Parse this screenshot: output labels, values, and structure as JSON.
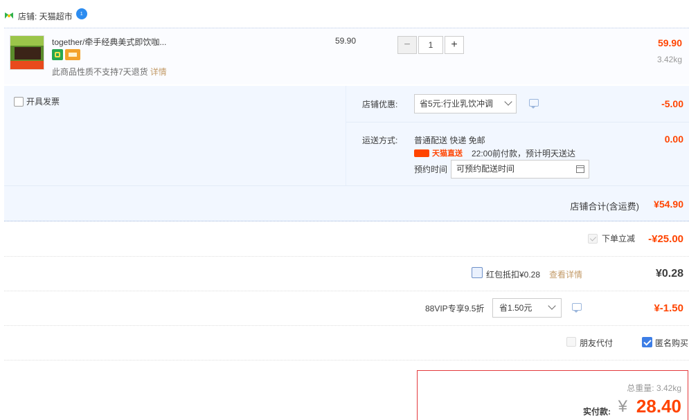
{
  "shop": {
    "label": "店铺: 天猫超市",
    "badge": "1"
  },
  "item": {
    "title": "together/牵手经典美式即饮咖...",
    "note": "此商品性质不支持7天退货",
    "note_link": "详情",
    "unit_price": "59.90",
    "quantity": "1",
    "minus": "−",
    "plus": "+",
    "total": "59.90",
    "weight": "3.42kg"
  },
  "invoice": {
    "label": "开具发票"
  },
  "shop_discount": {
    "label": "店铺优惠:",
    "selected": "省5元:行业乳饮冲调",
    "amount": "-5.00"
  },
  "shipping": {
    "label": "运送方式:",
    "method": "普通配送 快递 免邮",
    "tag": "天猫直送",
    "note": "22:00前付款，预计明天送达",
    "reserve_label": "预约时间",
    "reserve_placeholder": "可预约配送时间",
    "fee": "0.00"
  },
  "shop_total": {
    "label": "店铺合计(含运费)",
    "value": "¥54.90"
  },
  "instant_discount": {
    "label": "下单立减",
    "value": "-¥25.00"
  },
  "red_packet": {
    "label": "红包抵扣¥0.28",
    "link": "查看详情",
    "value": "¥0.28"
  },
  "vip": {
    "label": "88VIP专享9.5折",
    "selected": "省1.50元",
    "value": "¥-1.50"
  },
  "friend_pay": {
    "label": "朋友代付"
  },
  "anonymous": {
    "label": "匿名购买"
  },
  "payment": {
    "weight_label": "总重量: 3.42kg",
    "label": "实付款:",
    "currency": "¥",
    "amount": "28.40"
  },
  "colors": {
    "accent": "#ff4400",
    "panel": "#f2f7ff",
    "link": "#c39b68",
    "checkbox": "#3d7ee6"
  }
}
